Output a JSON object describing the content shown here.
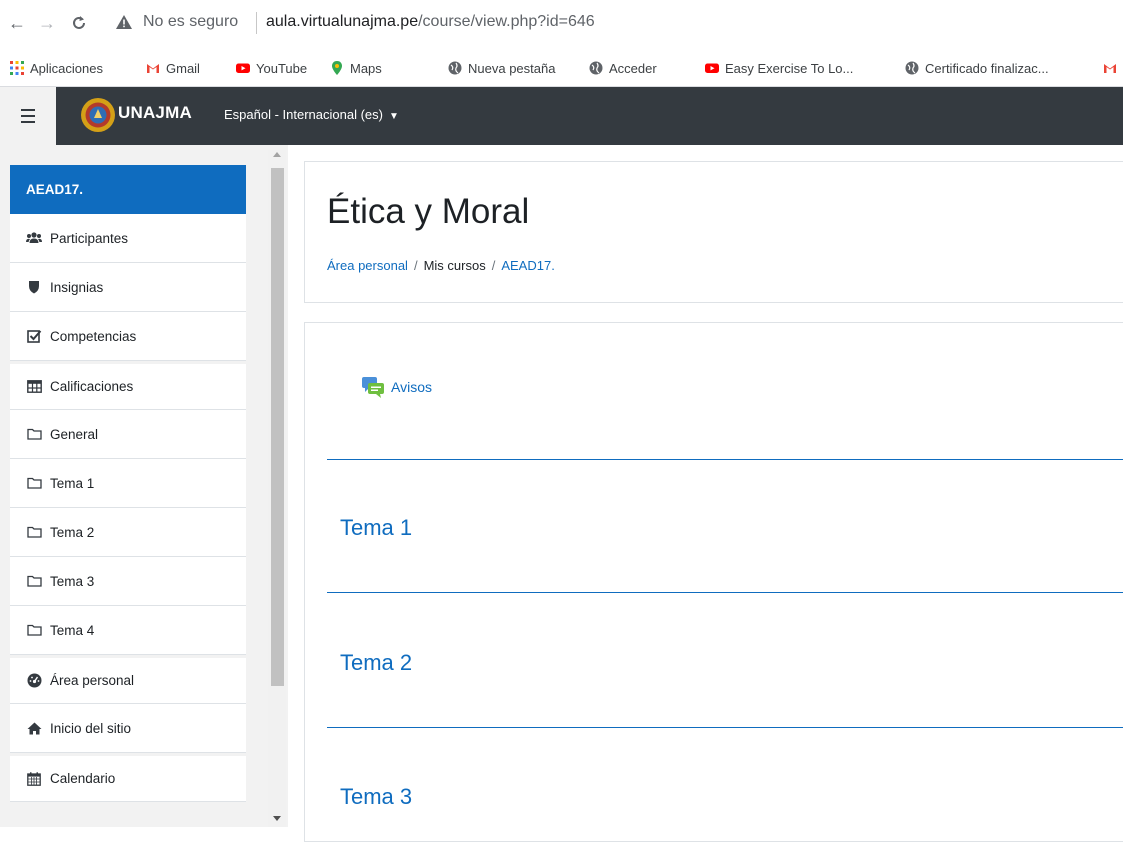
{
  "browser": {
    "security_text": "No es seguro",
    "url_host": "aula.virtualunajma.pe",
    "url_rest": "/course/view.php?id=646",
    "bookmarks": [
      {
        "label": "Aplicaciones",
        "icon": "apps-grid-icon"
      },
      {
        "label": "Gmail",
        "icon": "gmail-icon"
      },
      {
        "label": "YouTube",
        "icon": "youtube-icon"
      },
      {
        "label": "Maps",
        "icon": "maps-pin-icon"
      },
      {
        "label": "Nueva pestaña",
        "icon": "globe-icon"
      },
      {
        "label": "Acceder",
        "icon": "globe-icon"
      },
      {
        "label": "Easy Exercise To Lo...",
        "icon": "youtube-icon"
      },
      {
        "label": "Certificado finalizac...",
        "icon": "globe-icon"
      }
    ]
  },
  "navbar": {
    "site_name": "UNAJMA",
    "language": "Español - Internacional (es)"
  },
  "drawer": {
    "items": [
      {
        "label": "AEAD17.",
        "icon": ""
      },
      {
        "label": "Participantes",
        "icon": "users-icon"
      },
      {
        "label": "Insignias",
        "icon": "shield-icon"
      },
      {
        "label": "Competencias",
        "icon": "checkbox-icon"
      },
      {
        "label": "Calificaciones",
        "icon": "table-icon"
      },
      {
        "label": "General",
        "icon": "folder-icon"
      },
      {
        "label": "Tema 1",
        "icon": "folder-icon"
      },
      {
        "label": "Tema 2",
        "icon": "folder-icon"
      },
      {
        "label": "Tema 3",
        "icon": "folder-icon"
      },
      {
        "label": "Tema 4",
        "icon": "folder-icon"
      },
      {
        "label": "Área personal",
        "icon": "dashboard-icon"
      },
      {
        "label": "Inicio del sitio",
        "icon": "home-icon"
      },
      {
        "label": "Calendario",
        "icon": "calendar-icon"
      }
    ]
  },
  "header": {
    "course_title": "Ética y Moral",
    "breadcrumb": [
      "Área personal",
      "Mis cursos",
      "AEAD17."
    ]
  },
  "content": {
    "forum_label": "Avisos",
    "sections": [
      "Tema 1",
      "Tema 2",
      "Tema 3"
    ]
  },
  "colors": {
    "brand": "#0f6cbf",
    "navbar": "#343a40"
  }
}
